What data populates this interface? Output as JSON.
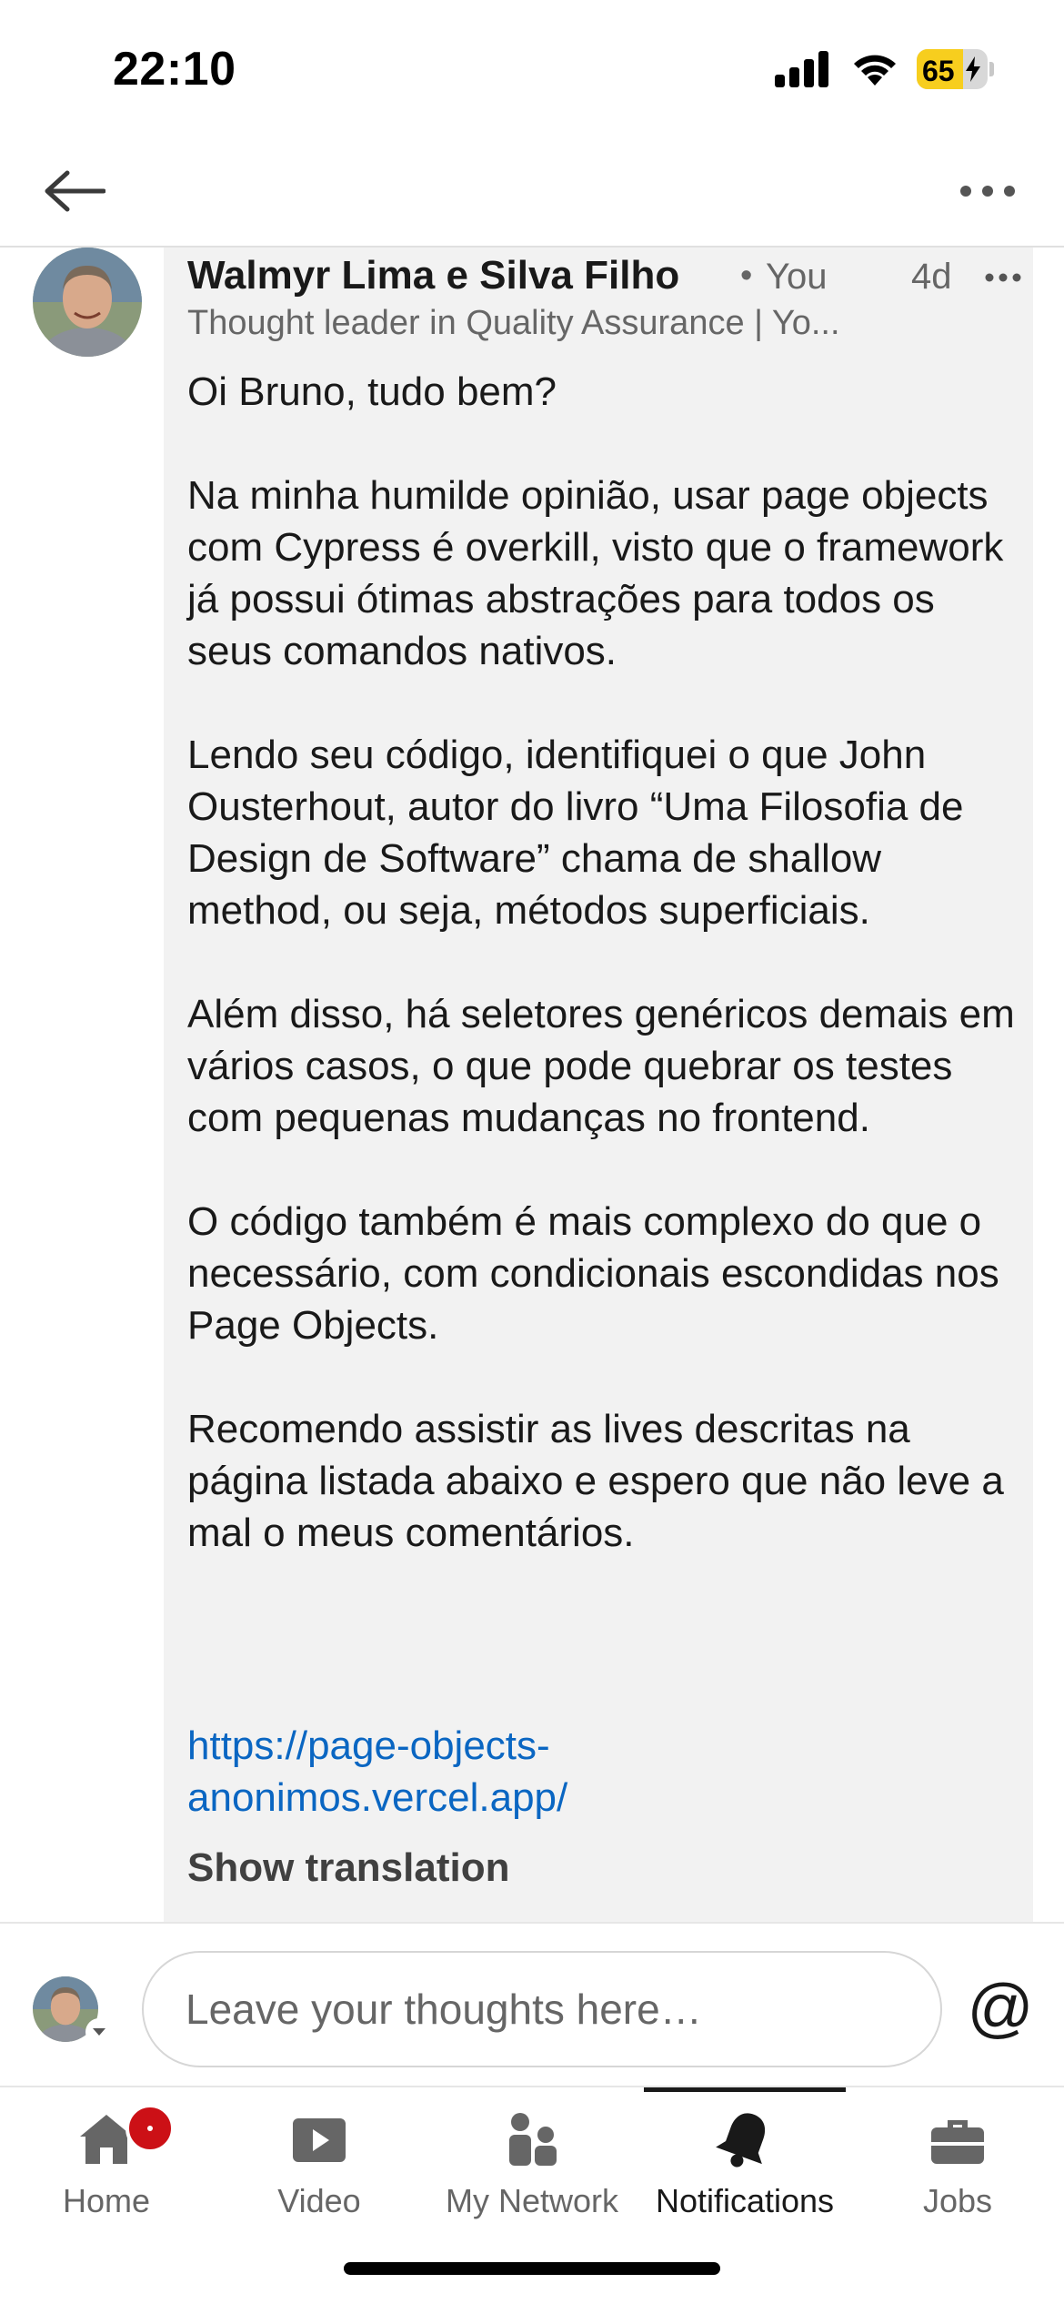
{
  "status_bar": {
    "time": "22:10",
    "battery_level": "65",
    "battery_fill_percent": 65,
    "icons": [
      "signal-icon",
      "wifi-icon",
      "battery-charging-icon"
    ]
  },
  "top_nav": {
    "back_icon": "arrow-left-icon",
    "more_icon": "more-horizontal-icon"
  },
  "comment": {
    "author": "Walmyr Lima e Silva Filho",
    "separator": "•",
    "you_label": "You",
    "time_ago": "4d",
    "headline": "Thought leader in Quality Assurance | Yo...",
    "paragraphs": [
      "Oi Bruno, tudo bem?",
      "Na minha humilde opinião, usar page objects com Cypress é overkill, visto que o framework já possui ótimas abstrações para todos os seus comandos nativos.",
      "Lendo seu código, identifiquei o que John Ousterhout, autor do livro “Uma Filosofia de Design de Software” chama de shallow method, ou seja, métodos superficiais.",
      "Além disso, há seletores genéricos demais em vários casos, o que pode quebrar os testes com pequenas mudanças no frontend.",
      "O código também é mais complexo do que o necessário, com condicionais escondidas nos Page Objects.",
      "Recomendo assistir as lives descritas na página listada abaixo e espero que não leve a mal o meus comentários."
    ],
    "link": "https://page-objects-\nanonimos.vercel.app/",
    "show_translation": "Show translation"
  },
  "composer": {
    "placeholder": "Leave your thoughts here…",
    "mention_symbol": "@"
  },
  "tabs": [
    {
      "label": "Home",
      "icon": "home-icon",
      "badge": true
    },
    {
      "label": "Video",
      "icon": "video-icon"
    },
    {
      "label": "My Network",
      "icon": "people-icon"
    },
    {
      "label": "Notifications",
      "icon": "bell-icon",
      "active": true
    },
    {
      "label": "Jobs",
      "icon": "briefcase-icon"
    }
  ],
  "colors": {
    "link": "#0a66c2",
    "bubble_bg": "#f2f2f2",
    "badge": "#cc1016",
    "battery": "#f7ce1e"
  }
}
